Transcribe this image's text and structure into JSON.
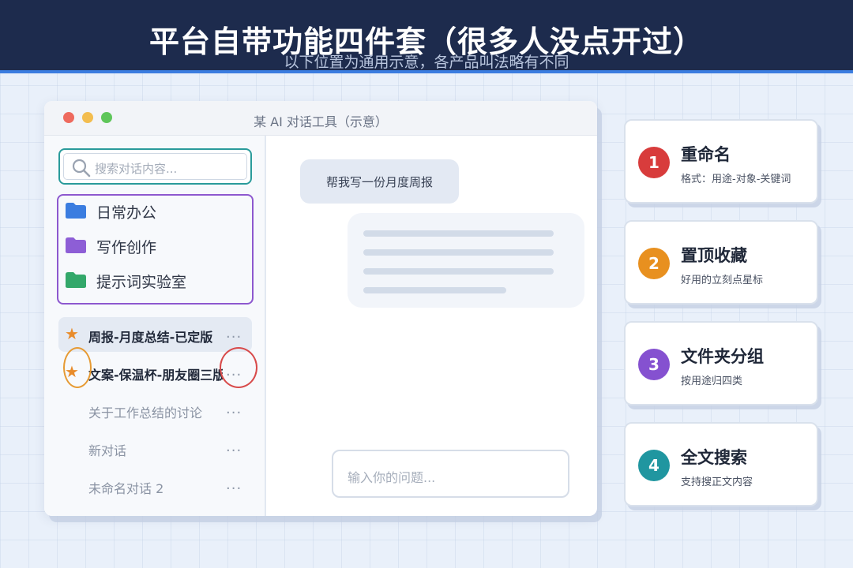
{
  "header": {
    "title": "平台自带功能四件套（很多人没点开过）",
    "subtitle": "以下位置为通用示意，各产品叫法略有不同"
  },
  "window": {
    "title": "某 AI 对话工具（示意）",
    "search_placeholder": "搜索对话内容...",
    "folders": [
      {
        "label": "日常办公",
        "icon": "blue-folder-icon",
        "color": "#3b7de0"
      },
      {
        "label": "写作创作",
        "icon": "purple-folder-icon",
        "color": "#8d5ed6"
      },
      {
        "label": "提示词实验室",
        "icon": "green-folder-icon",
        "color": "#33a86a"
      }
    ],
    "conversations": [
      {
        "name": "周报-月度总结-已定版",
        "starred": true,
        "bold": true,
        "more": "..."
      },
      {
        "name": "文案-保温杯-朋友圈三版",
        "starred": true,
        "bold": true,
        "more": "..."
      },
      {
        "name": "关于工作总结的讨论",
        "starred": false,
        "bold": false,
        "more": "..."
      },
      {
        "name": "新对话",
        "starred": false,
        "bold": false,
        "more": "..."
      },
      {
        "name": "未命名对话 2",
        "starred": false,
        "bold": false,
        "more": "..."
      }
    ],
    "user_message": "帮我写一份月度周报",
    "input_placeholder": "输入你的问题..."
  },
  "features": [
    {
      "number": "1",
      "title": "重命名",
      "desc": "格式：用途-对象-关键词",
      "color": "#d83c3c"
    },
    {
      "number": "2",
      "title": "置顶收藏",
      "desc": "好用的立刻点星标",
      "color": "#e8901f"
    },
    {
      "number": "3",
      "title": "文件夹分组",
      "desc": "按用途归四类",
      "color": "#8551d0"
    },
    {
      "number": "4",
      "title": "全文搜索",
      "desc": "支持搜正文内容",
      "color": "#2096a0"
    }
  ],
  "colors": {
    "header_bg": "#1d2b4d",
    "accent_blue": "#3b7de0",
    "star": "#e88b2a"
  }
}
